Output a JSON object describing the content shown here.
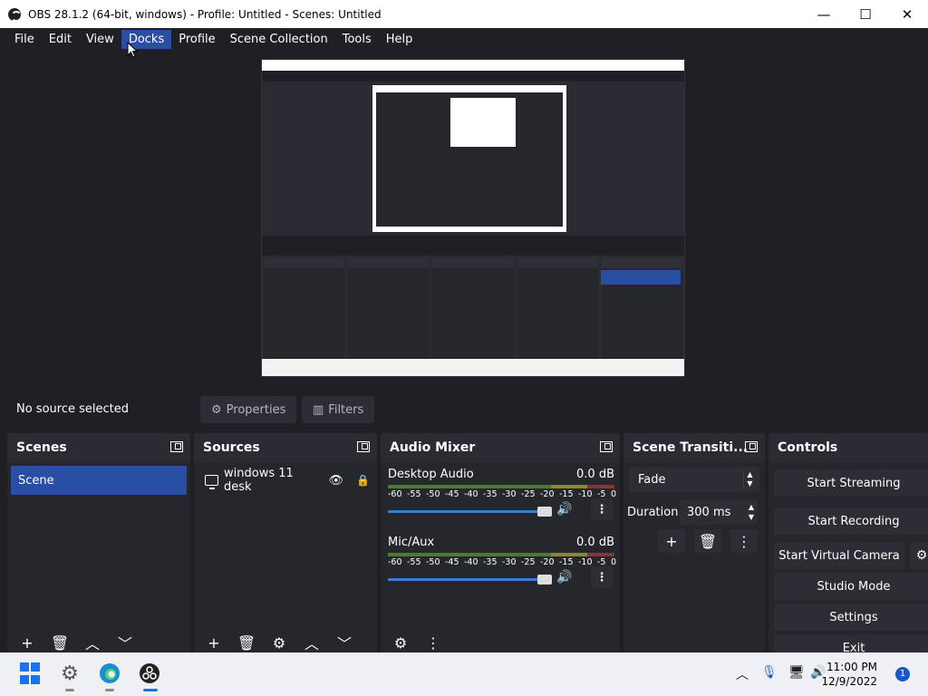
{
  "window": {
    "title": "OBS 28.1.2 (64-bit, windows) - Profile: Untitled - Scenes: Untitled",
    "minimize": "—",
    "maximize": "☐",
    "close": "✕"
  },
  "menu": [
    "File",
    "Edit",
    "View",
    "Docks",
    "Profile",
    "Scene Collection",
    "Tools",
    "Help"
  ],
  "source_bar": {
    "status": "No source selected",
    "properties": "Properties",
    "filters": "Filters"
  },
  "docks": {
    "scenes": {
      "title": "Scenes",
      "items": [
        "Scene"
      ]
    },
    "sources": {
      "title": "Sources",
      "items": [
        "windows 11 desk"
      ]
    },
    "audio": {
      "title": "Audio Mixer",
      "channels": [
        {
          "name": "Desktop Audio",
          "db": "0.0 dB"
        },
        {
          "name": "Mic/Aux",
          "db": "0.0 dB"
        }
      ],
      "ticks": [
        "-60",
        "-55",
        "-50",
        "-45",
        "-40",
        "-35",
        "-30",
        "-25",
        "-20",
        "-15",
        "-10",
        "-5",
        "0"
      ]
    },
    "transitions": {
      "title": "Scene Transiti...",
      "selected": "Fade",
      "duration_label": "Duration",
      "duration_value": "300 ms"
    },
    "controls": {
      "title": "Controls",
      "start_streaming": "Start Streaming",
      "start_recording": "Start Recording",
      "start_virtual_camera": "Start Virtual Camera",
      "studio_mode": "Studio Mode",
      "settings": "Settings",
      "exit": "Exit"
    }
  },
  "taskbar": {
    "time": "11:00 PM",
    "date": "12/9/2022",
    "notifications": "1"
  }
}
